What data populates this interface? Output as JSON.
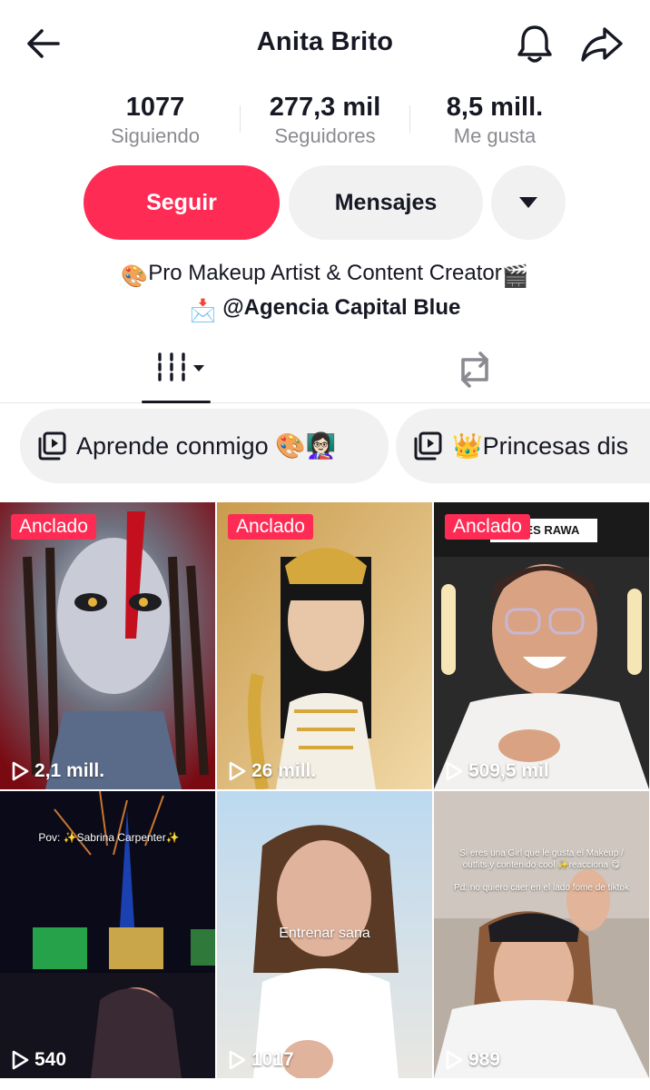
{
  "header": {
    "title": "Anita Brito",
    "back_icon": "arrow-left-icon",
    "bell_icon": "bell-icon",
    "share_icon": "share-arrow-icon"
  },
  "stats": {
    "following": {
      "value": "1077",
      "label": "Siguiendo"
    },
    "followers": {
      "value": "277,3 mil",
      "label": "Seguidores"
    },
    "likes": {
      "value": "8,5 mill.",
      "label": "Me gusta"
    }
  },
  "actions": {
    "follow_label": "Seguir",
    "message_label": "Mensajes",
    "more_icon": "caret-down-icon",
    "follow_color": "#fe2c55"
  },
  "bio": {
    "line1_prefix": "🎨",
    "line1_text": "Pro Makeup Artist & Content Creator",
    "line1_suffix": "🎬",
    "line2_prefix": "📩",
    "line2_text": " @Agencia Capital Blue"
  },
  "tabs": {
    "videos_icon": "grid-columns-icon",
    "repost_icon": "repost-icon"
  },
  "playlists": [
    {
      "icon": "playlist-icon",
      "label": "Aprende conmigo 🎨👩🏻‍🏫"
    },
    {
      "icon": "playlist-icon",
      "label": "👑Princesas dis"
    }
  ],
  "videos": [
    {
      "pinned": "Anclado",
      "views": "2,1 mill.",
      "overlay": ""
    },
    {
      "pinned": "Anclado",
      "views": "26 mill.",
      "overlay": ""
    },
    {
      "pinned": "Anclado",
      "views": "509,5 mil",
      "overlay": "ADES RAWA"
    },
    {
      "pinned": "",
      "views": "540",
      "overlay": "Pov: ✨Sabrina Carpenter✨"
    },
    {
      "pinned": "",
      "views": "1017",
      "overlay": "Entrenar sana"
    },
    {
      "pinned": "",
      "views": "989",
      "overlay": "Si eres una Girl que le gusta el Makeup / outfits y contenido cool ✨reacciona 😋",
      "overlay2": "Pd: no quiero caer en el lado fome de tiktok"
    }
  ]
}
